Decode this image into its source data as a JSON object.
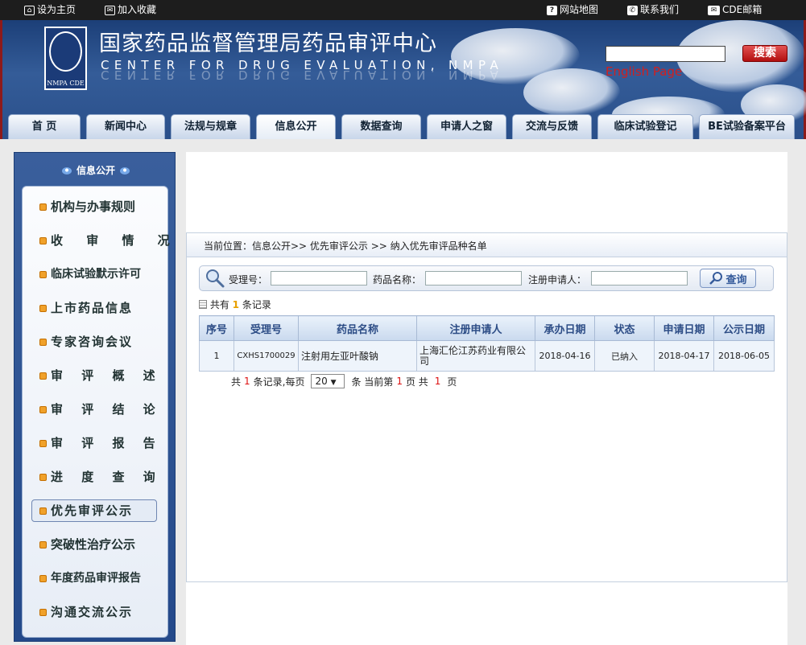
{
  "topbar": {
    "set_home": "设为主页",
    "add_favorite": "加入收藏",
    "site_map": "网站地图",
    "contact": "联系我们",
    "mail": "CDE邮箱"
  },
  "header": {
    "logo_text": "NMPA CDE",
    "title_cn": "国家药品监督管理局药品审评中心",
    "title_en": "CENTER FOR DRUG EVALUATION, NMPA",
    "search_button": "搜索",
    "english_link": "English Page"
  },
  "nav": {
    "tabs": [
      "首 页",
      "新闻中心",
      "法规与规章",
      "信息公开",
      "数据查询",
      "申请人之窗",
      "交流与反馈",
      "临床试验登记",
      "BE试验备案平台"
    ],
    "active": "信息公开"
  },
  "sidebar": {
    "title": "信息公开",
    "items": [
      "机构与办事规则",
      "收 审 情 况",
      "临床试验默示许可",
      "上市药品信息",
      "专家咨询会议",
      "审 评 概 述",
      "审 评 结 论",
      "审 评 报 告",
      "进 度 查 询",
      "优先审评公示",
      "突破性治疗公示",
      "年度药品审评报告",
      "沟通交流公示"
    ],
    "active_index": 9
  },
  "breadcrumb": "当前位置：信息公开>> 优先审评公示 >> 纳入优先审评品种名单",
  "query": {
    "accept_no_label": "受理号：",
    "drug_name_label": "药品名称：",
    "applicant_label": "注册申请人：",
    "button": "查询"
  },
  "summary": {
    "prefix": "共有",
    "count": "1",
    "suffix": "条记录"
  },
  "table": {
    "headers": [
      "序号",
      "受理号",
      "药品名称",
      "注册申请人",
      "承办日期",
      "状态",
      "申请日期",
      "公示日期"
    ],
    "rows": [
      [
        "1",
        "CXHS1700029",
        "注射用左亚叶酸钠",
        "上海汇伦江苏药业有限公司",
        "2018-04-16",
        "已纳入",
        "2018-04-17",
        "2018-06-05"
      ]
    ]
  },
  "pager": {
    "total_prefix": "共",
    "total": "1",
    "per_page_label": "条记录,每页",
    "page_size": "20",
    "current_prefix": "条 当前第",
    "current": "1",
    "pages_prefix": "页 共",
    "pages": "1",
    "pages_suffix": "页"
  },
  "colors": {
    "red": "#d11f1f",
    "nav_blue": "#2a4f8a",
    "header_dark": "#1d1d1d"
  }
}
